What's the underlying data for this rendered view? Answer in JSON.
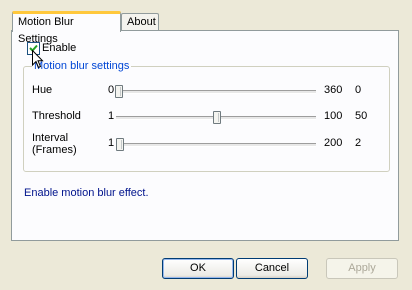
{
  "tabs": [
    {
      "label": "Motion Blur Settings"
    },
    {
      "label": "About"
    }
  ],
  "enable": {
    "label": "Enable",
    "checked": true
  },
  "group": {
    "title": "Motion blur settings",
    "rows": [
      {
        "label": "Hue",
        "min": "0",
        "max": "360",
        "value": "0"
      },
      {
        "label": "Threshold",
        "min": "1",
        "max": "100",
        "value": "50"
      },
      {
        "label_line1": "Interval",
        "label_line2": "(Frames)",
        "min": "1",
        "max": "200",
        "value": "2"
      }
    ]
  },
  "description": "Enable motion blur effect.",
  "buttons": {
    "ok": "OK",
    "cancel": "Cancel",
    "apply": "Apply"
  },
  "colors": {
    "group_title": "#0046d5",
    "description": "#00138c",
    "tab_highlight": "#ffc83c"
  }
}
